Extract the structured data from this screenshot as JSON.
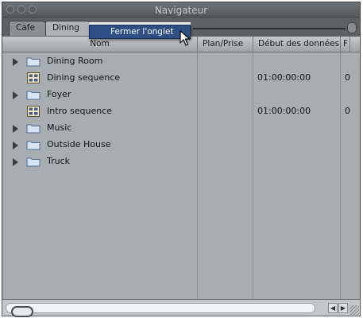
{
  "window": {
    "title": "Navigateur"
  },
  "tabs": [
    {
      "label": "Cafe",
      "active": false
    },
    {
      "label": "Dining",
      "active": true
    }
  ],
  "columns": {
    "name": "Nom",
    "clip": "Plan/Prise",
    "media_start": "Début des données",
    "extra": "F"
  },
  "rows": [
    {
      "icon": "folder-icon",
      "label": "Dining Room",
      "expandable": true,
      "media_start": "",
      "extra": ""
    },
    {
      "icon": "sequence-icon",
      "label": "Dining sequence",
      "expandable": false,
      "media_start": "01:00:00:00",
      "extra": "0"
    },
    {
      "icon": "folder-icon",
      "label": "Foyer",
      "expandable": true,
      "media_start": "",
      "extra": ""
    },
    {
      "icon": "sequence-icon",
      "label": "Intro sequence",
      "expandable": false,
      "media_start": "01:00:00:00",
      "extra": "0"
    },
    {
      "icon": "folder-icon",
      "label": "Music",
      "expandable": true,
      "media_start": "",
      "extra": ""
    },
    {
      "icon": "folder-icon",
      "label": "Outside House",
      "expandable": true,
      "media_start": "",
      "extra": ""
    },
    {
      "icon": "folder-icon",
      "label": "Truck",
      "expandable": true,
      "media_start": "",
      "extra": ""
    }
  ],
  "context_menu": {
    "item": "Fermer l'onglet"
  },
  "colors": {
    "menu_highlight": "#2e4f86",
    "content_bg": "#a8adb1"
  }
}
